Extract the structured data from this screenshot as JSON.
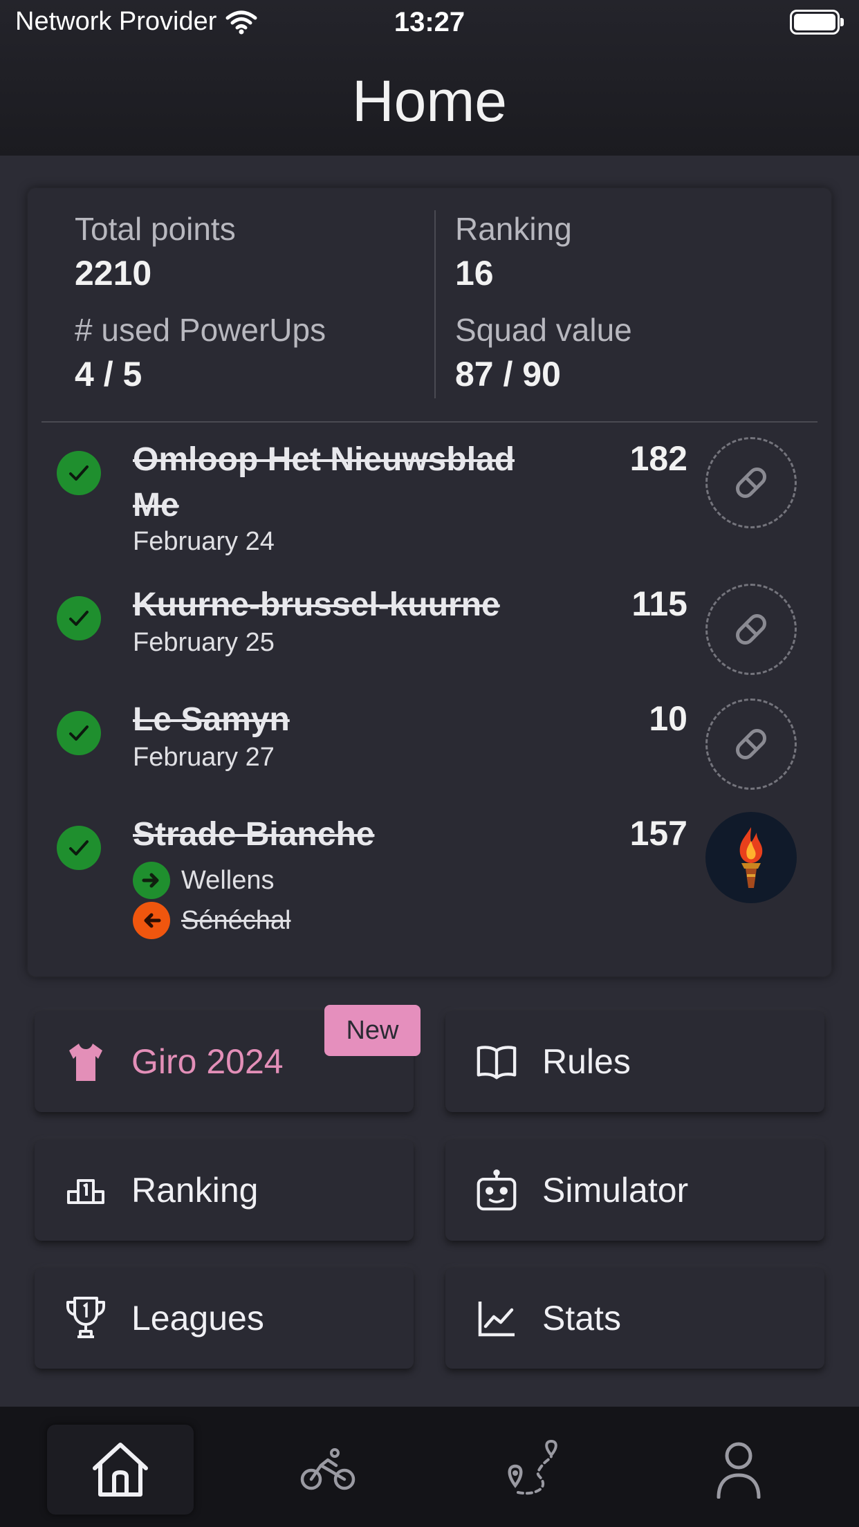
{
  "status_bar": {
    "carrier": "Network Provider",
    "time": "13:27"
  },
  "header": {
    "title": "Home"
  },
  "summary": {
    "total_points_label": "Total points",
    "total_points": "2210",
    "ranking_label": "Ranking",
    "ranking": "16",
    "powerups_label": "# used PowerUps",
    "powerups": "4 / 5",
    "squad_value_label": "Squad value",
    "squad_value": "87 / 90"
  },
  "races": [
    {
      "name": "Omloop Het Nieuwsblad Me",
      "date": "February 24",
      "points": "182",
      "powerup": "pill-icon"
    },
    {
      "name": "Kuurne-brussel-kuurne",
      "date": "February 25",
      "points": "115",
      "powerup": "pill-icon"
    },
    {
      "name": "Le Samyn",
      "date": "February 27",
      "points": "10",
      "powerup": "pill-icon"
    },
    {
      "name": "Strade Bianche",
      "date": "",
      "points": "157",
      "powerup": "torch-icon",
      "transfer_in": "Wellens",
      "transfer_out": "Sénéchal"
    }
  ],
  "menu": {
    "giro": "Giro 2024",
    "giro_badge": "New",
    "rules": "Rules",
    "ranking": "Ranking",
    "simulator": "Simulator",
    "leagues": "Leagues",
    "stats": "Stats"
  },
  "tabs": [
    "home-icon",
    "bike-icon",
    "route-icon",
    "profile-icon"
  ],
  "colors": {
    "background": "#2c2c35",
    "card": "#2a2a33",
    "check_green": "#1f8f2e",
    "transfer_in_green": "#1f8f2e",
    "transfer_out_orange": "#f0560e",
    "giro_pink": "#e38fb8",
    "badge_pink": "#e58fbd"
  }
}
